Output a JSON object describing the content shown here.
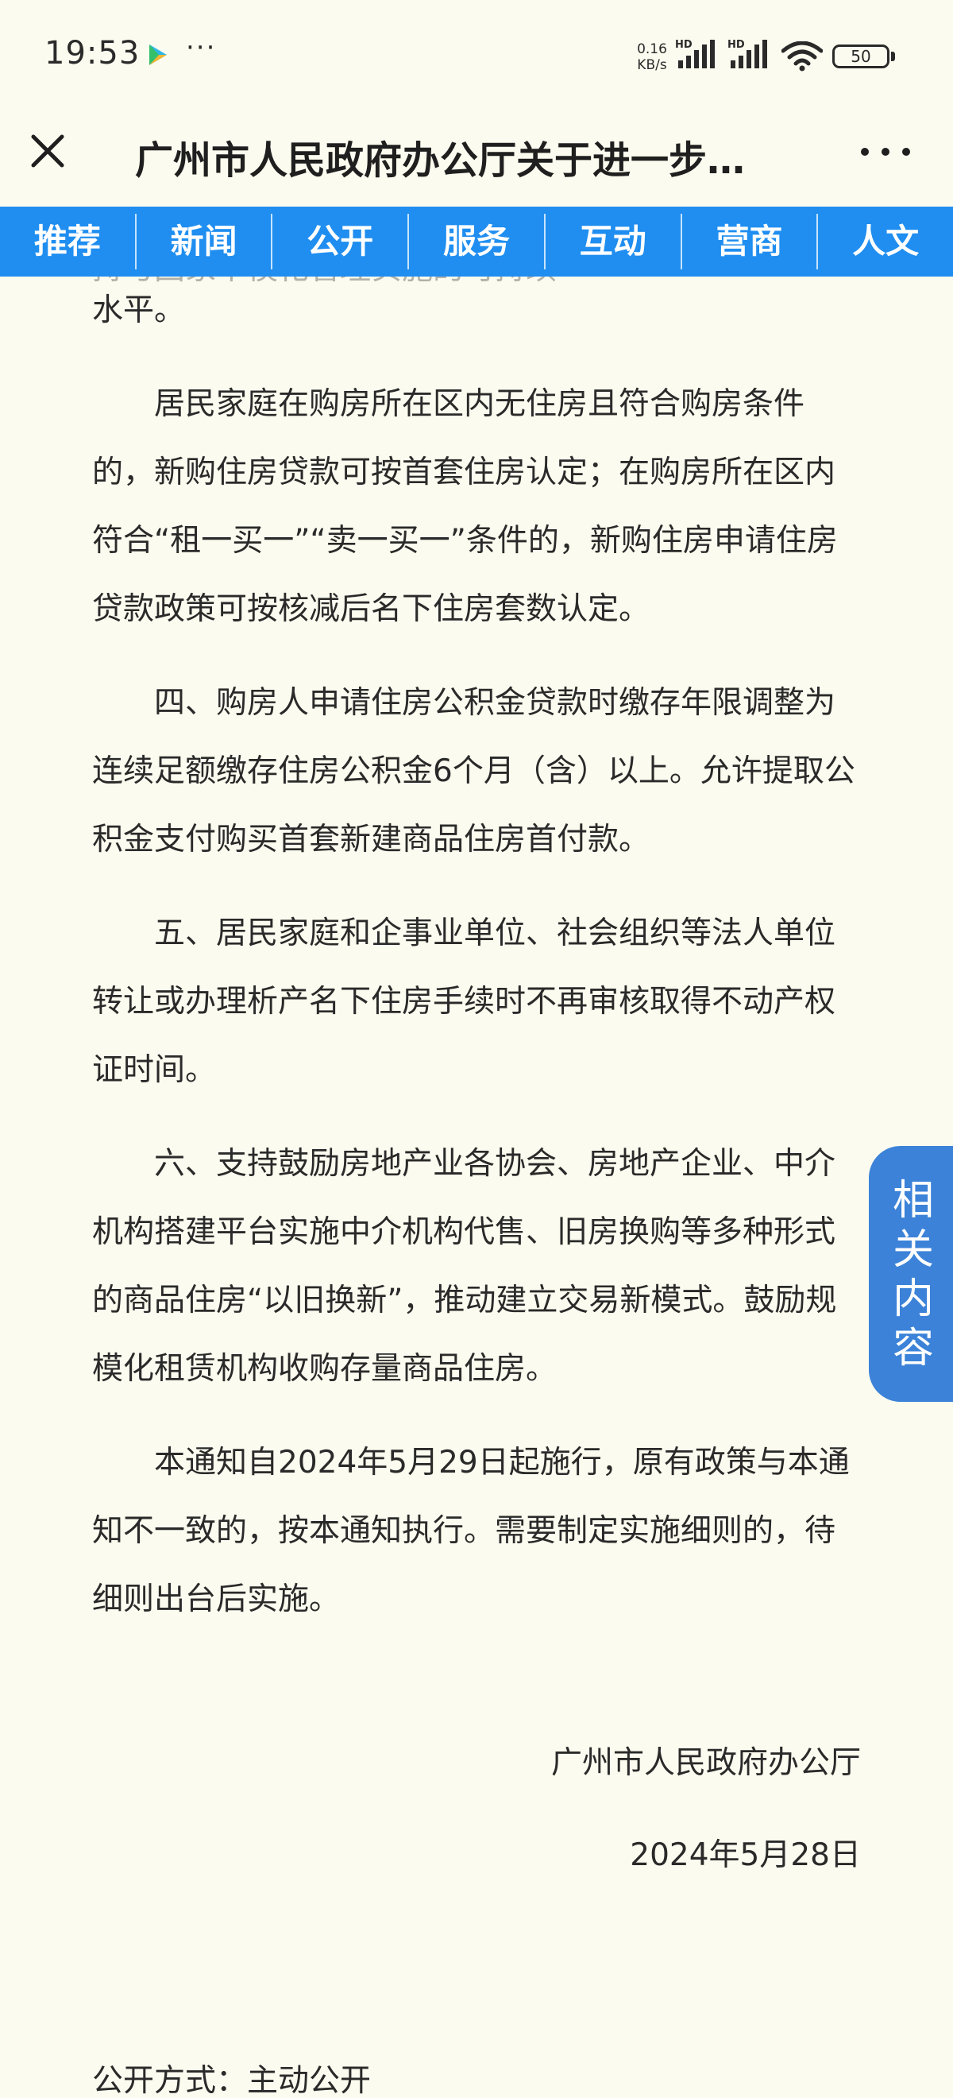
{
  "status_bar": {
    "time": "19:53",
    "more": "···",
    "speed_value": "0.16",
    "speed_unit": "KB/s",
    "signal1_label": "HD",
    "signal2_label": "HD",
    "battery": "50",
    "icons": [
      "play-store-icon",
      "signal-icon",
      "wifi-icon",
      "battery-icon"
    ]
  },
  "header": {
    "title": "广州市人民政府办公厅关于进一步…",
    "icons": [
      "close-icon",
      "more-options-icon"
    ]
  },
  "nav": {
    "tabs": [
      {
        "label": "推荐"
      },
      {
        "label": "新闻"
      },
      {
        "label": "公开"
      },
      {
        "label": "服务"
      },
      {
        "label": "互动"
      },
      {
        "label": "营商"
      },
      {
        "label": "人文"
      }
    ],
    "color": "#1f8ef0"
  },
  "article": {
    "cut_off_top": "持与国家中模化管理实施的可持续",
    "paragraphs": [
      {
        "text": "水平。",
        "continuation": true
      },
      {
        "text": "居民家庭在购房所在区内无住房且符合购房条件的，新购住房贷款可按首套住房认定；在购房所在区内符合“租一买一”“卖一买一”条件的，新购住房申请住房贷款政策可按核减后名下住房套数认定。",
        "continuation": false
      },
      {
        "text": "四、购房人申请住房公积金贷款时缴存年限调整为连续足额缴存住房公积金6个月（含）以上。允许提取公积金支付购买首套新建商品住房首付款。",
        "continuation": false
      },
      {
        "text": "五、居民家庭和企事业单位、社会组织等法人单位转让或办理析产名下住房手续时不再审核取得不动产权证时间。",
        "continuation": false
      },
      {
        "text": "六、支持鼓励房地产业各协会、房地产企业、中介机构搭建平台实施中介机构代售、旧房换购等多种形式的商品住房“以旧换新”，推动建立交易新模式。鼓励规模化租赁机构收购存量商品住房。",
        "continuation": false
      },
      {
        "text": "本通知自2024年5月29日起施行，原有政策与本通知不一致的，按本通知执行。需要制定实施细则的，待细则出台后实施。",
        "continuation": false
      }
    ],
    "signature_org": "广州市人民政府办公厅",
    "signature_date": "2024年5月28日",
    "disclosure": "公开方式：主动公开"
  },
  "related": {
    "label": "相关内容",
    "color": "#3b82d8"
  }
}
